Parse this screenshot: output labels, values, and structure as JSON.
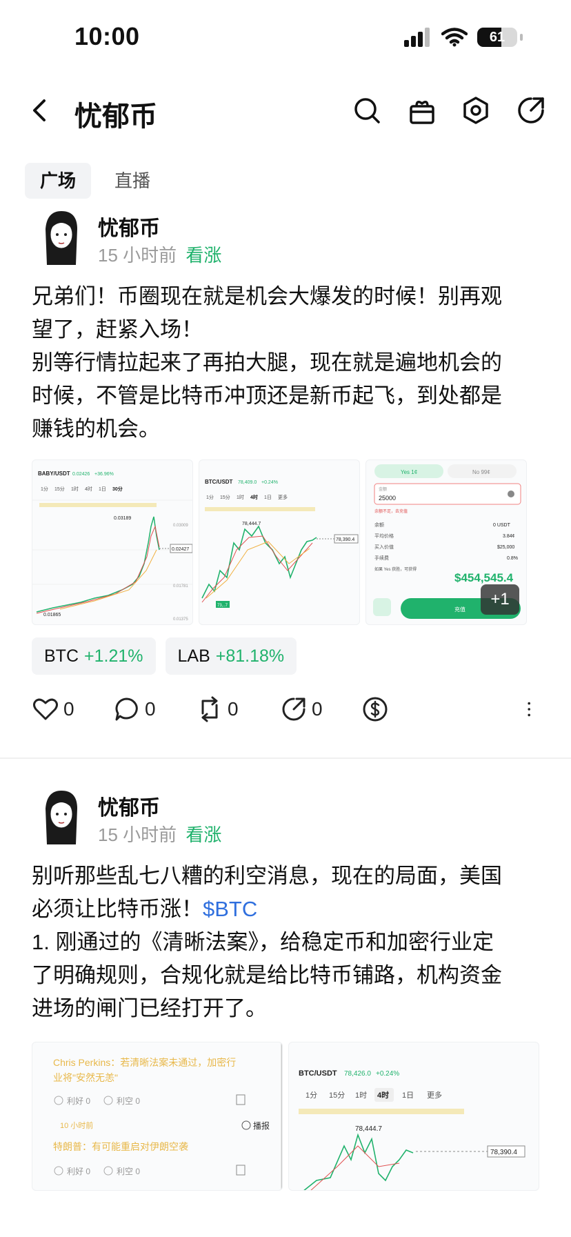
{
  "status": {
    "time": "10:00",
    "battery": "61",
    "battery_level": 0.61
  },
  "header": {
    "title": "忧郁币",
    "icons": [
      "back-icon",
      "search-icon",
      "gift-icon",
      "settings-icon",
      "share-icon"
    ]
  },
  "tabs": [
    {
      "label": "广场",
      "active": true
    },
    {
      "label": "直播",
      "active": false
    }
  ],
  "posts": [
    {
      "author": "忧郁币",
      "time": "15 小时前",
      "sentiment": "看涨",
      "lines": [
        "兄弟们！币圈现在就是机会大爆发的时候！别再观",
        "望了，赶紧入场！",
        "别等行情拉起来了再拍大腿，现在就是遍地机会的",
        "时候，不管是比特币冲顶还是新币起飞，到处都是",
        "赚钱的机会。"
      ],
      "image_more": "+1",
      "coins": [
        {
          "symbol": "BTC",
          "change": "+1.21%"
        },
        {
          "symbol": "LAB",
          "change": "+81.18%"
        }
      ],
      "actions": {
        "likes": "0",
        "comments": "0",
        "reposts": "0",
        "shares": "0"
      },
      "thumbs": {
        "chart1": {
          "pair": "BABY/USDT",
          "price": "0.02426",
          "pct": "+36.96%",
          "tabs": [
            "1分",
            "15分",
            "1时",
            "4时",
            "1日",
            "30分"
          ],
          "high": "0.03189",
          "last": "0.02427",
          "low": "0.01865",
          "axis": [
            "0.03009",
            "0.02427",
            "0.01781",
            "0.01375"
          ]
        },
        "chart2": {
          "pair": "BTC/USDT",
          "price": "78,409.0",
          "pct": "+0.24%",
          "tabs": [
            "1分",
            "15分",
            "1时",
            "4时",
            "1日",
            "更多"
          ],
          "high": "78,444.7",
          "last": "78,390.4",
          "low": "73,..7"
        },
        "order": {
          "yes": "Yes 1¢",
          "no": "No 99¢",
          "label": "金额",
          "amount": "25000",
          "warn": "余额不足，去充值",
          "rows": [
            [
              "余额",
              "0 USDT"
            ],
            [
              "平均价格",
              "3.84¢"
            ],
            [
              "买入价值",
              "$25,000"
            ],
            [
              "手续费",
              "0.8%"
            ]
          ],
          "payout_label": "如果 Yes 获胜，可获得",
          "payout": "$454,545.4",
          "button": "充值"
        }
      }
    },
    {
      "author": "忧郁币",
      "time": "15 小时前",
      "sentiment": "看涨",
      "lines": [
        "别听那些乱七八糟的利空消息，现在的局面，美国",
        "必须让比特币涨！",
        "1. 刚通过的《清晰法案》，给稳定币和加密行业定",
        "了明确规则，合规化就是给比特币铺路，机构资金",
        "进场的闸门已经打开了。"
      ],
      "cashtag": "$BTC",
      "thumbs": {
        "news": {
          "line1": "Chris Perkins：若清晰法案未通过，加密行",
          "line2": "业将\"安然无恙\"",
          "bull": "利好 0",
          "bear": "利空 0",
          "time": "10 小时前",
          "replay": "播报",
          "line3": "特朗普：有可能重启对伊朗空袭"
        },
        "chart": {
          "pair": "BTC/USDT",
          "price": "78,426.0",
          "pct": "+0.24%",
          "tabs": [
            "1分",
            "15分",
            "1时",
            "4时",
            "1日",
            "更多"
          ],
          "high": "78,444.7",
          "last": "78,390.4"
        }
      }
    }
  ]
}
